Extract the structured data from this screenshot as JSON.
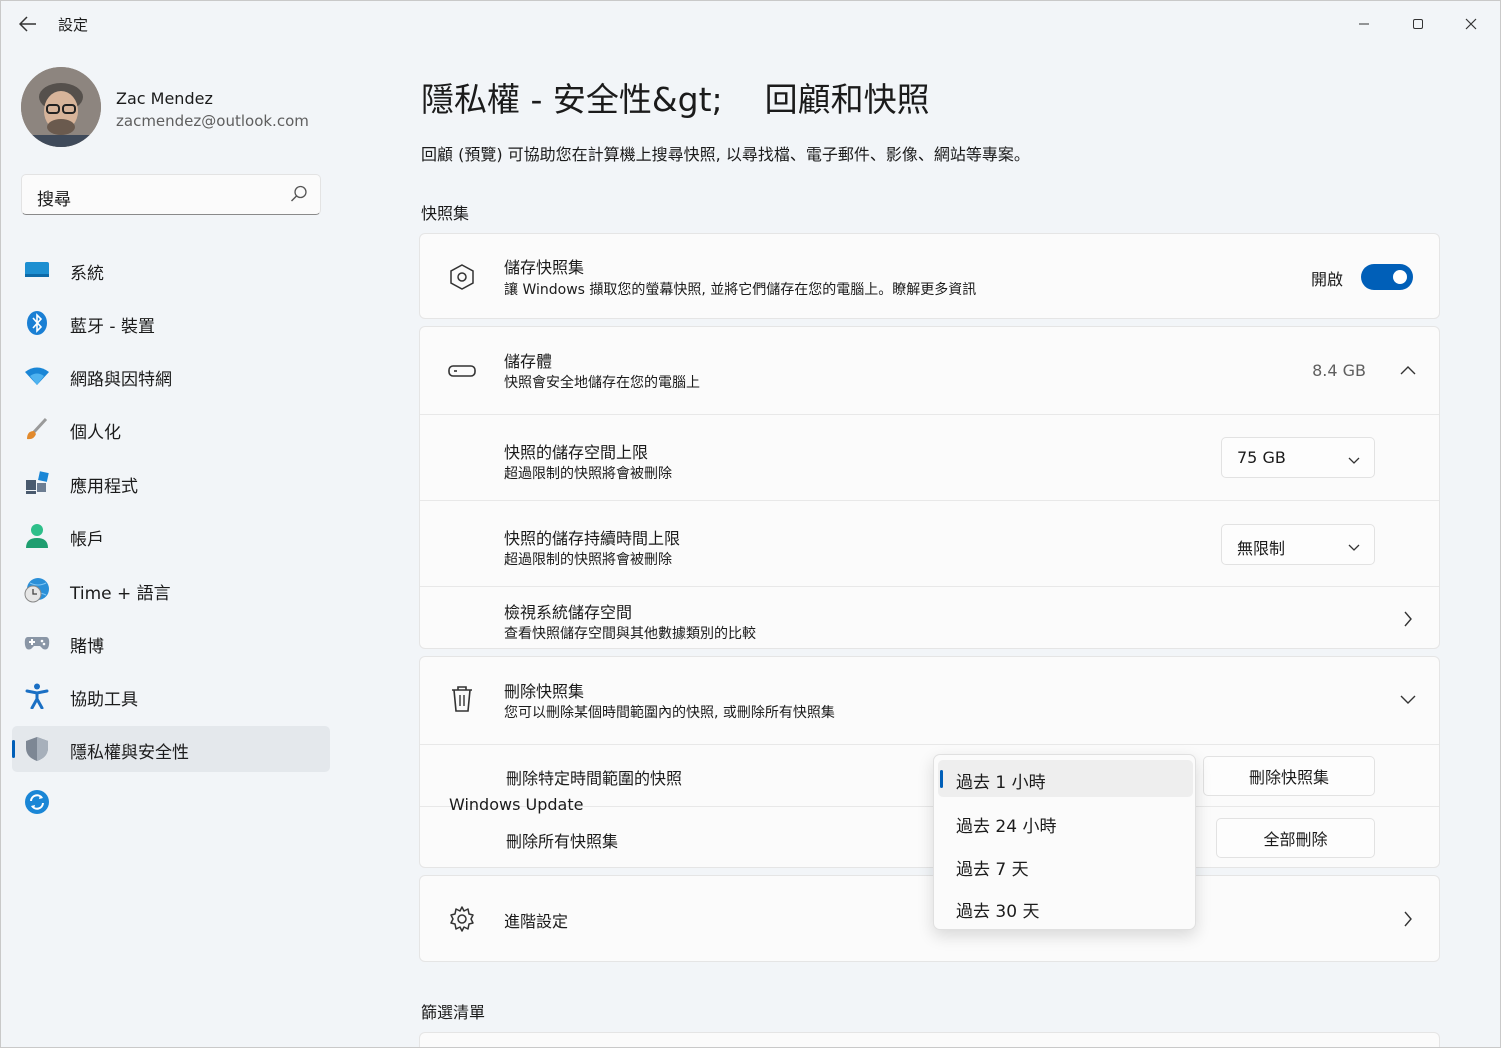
{
  "window": {
    "title": "設定",
    "back_icon": "arrow-left-icon",
    "minimize_icon": "minimize-icon",
    "maximize_icon": "maximize-icon",
    "close_icon": "close-icon"
  },
  "user": {
    "name": "Zac Mendez",
    "email": "zacmendez@outlook.com"
  },
  "search": {
    "placeholder": "搜尋",
    "icon": "search-icon"
  },
  "sidebar": {
    "items": [
      {
        "label": "系統",
        "icon": "system-display-icon"
      },
      {
        "label": "藍牙 - 裝置",
        "icon": "bluetooth-icon"
      },
      {
        "label": "網路與因特網",
        "icon": "wifi-icon"
      },
      {
        "label": "個人化",
        "icon": "paintbrush-icon"
      },
      {
        "label": "應用程式",
        "icon": "apps-icon"
      },
      {
        "label": "帳戶",
        "icon": "person-icon"
      },
      {
        "label": "Time + 語言",
        "icon": "globe-clock-icon"
      },
      {
        "label": "賭博",
        "icon": "gamepad-icon"
      },
      {
        "label": "協助工具",
        "icon": "accessibility-icon"
      },
      {
        "label": "隱私權與安全性",
        "icon": "shield-icon",
        "selected": true
      },
      {
        "label": "",
        "icon": "windows-update-icon"
      }
    ]
  },
  "main": {
    "title": "隱私權 - 安全性&gt;    回顧和快照",
    "description": "回顧 (預覽) 可協助您在計算機上搜尋快照, 以尋找檔、電子郵件、影像、網站等專案。",
    "section_snapshots": "快照集",
    "save_snapshots": {
      "title": "儲存快照集",
      "subtitle": "讓 Windows 擷取您的螢幕快照, 並將它們儲存在您的電腦上。瞭解更多資訊",
      "toggle_label": "開啟",
      "toggle_on": true
    },
    "storage": {
      "title": "儲存體",
      "subtitle": "快照會安全地儲存在您的電腦上",
      "value": "8.4 GB"
    },
    "storage_limit": {
      "title": "快照的儲存空間上限",
      "subtitle": "超過限制的快照將會被刪除",
      "selected": "75 GB"
    },
    "duration_limit": {
      "title": "快照的儲存持續時間上限",
      "subtitle": "超過限制的快照將會被刪除",
      "selected": "無限制"
    },
    "view_storage": {
      "title": "檢視系統儲存空間",
      "subtitle": "查看快照儲存空間與其他數據類別的比較"
    },
    "delete_snapshots": {
      "title": "刪除快照集",
      "subtitle": "您可以刪除某個時間範圍內的快照, 或刪除所有快照集",
      "range_label": "刪除特定時間範圍的快照",
      "range_button": "刪除快照集",
      "all_label": "刪除所有快照集",
      "all_button": "全部刪除"
    },
    "advanced": {
      "title": "進階設定"
    },
    "section_filter": "篩選清單",
    "overlay_label": "Windows Update"
  },
  "time_range_flyout": {
    "options": [
      "過去 1 小時",
      "過去 24 小時",
      "過去 7 天",
      "過去 30 天"
    ],
    "selected_index": 0
  },
  "colors": {
    "accent": "#005fb8",
    "window_bg": "#f2f5f8",
    "card_bg": "#fbfbfb"
  }
}
